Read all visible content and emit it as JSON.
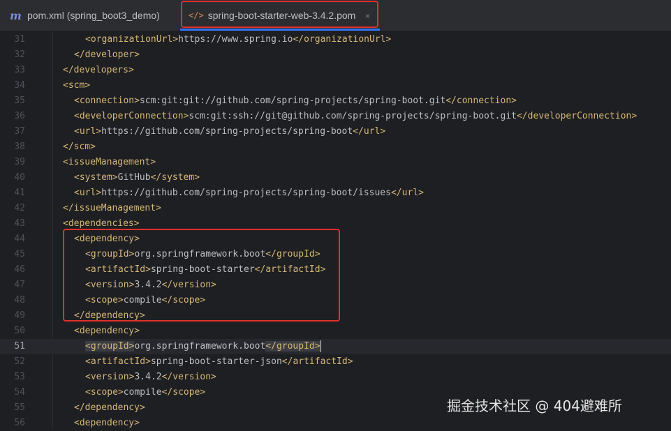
{
  "tabs": [
    {
      "icon": "maven-icon",
      "glyph": "m",
      "label": "pom.xml (spring_boot3_demo)"
    },
    {
      "icon": "xml-icon",
      "glyph": "</>",
      "label": "spring-boot-starter-web-3.4.2.pom",
      "close": "×"
    }
  ],
  "colors": {
    "tag": "#d5b778",
    "text": "#bcbec4",
    "accent": "#3574f0",
    "highlight": "#e0302c"
  },
  "lines": [
    {
      "n": "31",
      "indent": 2,
      "open": "organizationUrl",
      "text": "https://www.spring.io",
      "close": "organizationUrl"
    },
    {
      "n": "32",
      "indent": 1,
      "close": "developer"
    },
    {
      "n": "33",
      "indent": 0,
      "close": "developers"
    },
    {
      "n": "34",
      "indent": 0,
      "open": "scm"
    },
    {
      "n": "35",
      "indent": 1,
      "open": "connection",
      "text": "scm:git:git://github.com/spring-projects/spring-boot.git",
      "close": "connection"
    },
    {
      "n": "36",
      "indent": 1,
      "open": "developerConnection",
      "text": "scm:git:ssh://git@github.com/spring-projects/spring-boot.git",
      "close": "developerConnection"
    },
    {
      "n": "37",
      "indent": 1,
      "open": "url",
      "text": "https://github.com/spring-projects/spring-boot",
      "close": "url"
    },
    {
      "n": "38",
      "indent": 0,
      "close": "scm"
    },
    {
      "n": "39",
      "indent": 0,
      "open": "issueManagement"
    },
    {
      "n": "40",
      "indent": 1,
      "open": "system",
      "text": "GitHub",
      "close": "system"
    },
    {
      "n": "41",
      "indent": 1,
      "open": "url",
      "text": "https://github.com/spring-projects/spring-boot/issues",
      "close": "url"
    },
    {
      "n": "42",
      "indent": 0,
      "close": "issueManagement"
    },
    {
      "n": "43",
      "indent": 0,
      "open": "dependencies"
    },
    {
      "n": "44",
      "indent": 1,
      "open": "dependency"
    },
    {
      "n": "45",
      "indent": 2,
      "open": "groupId",
      "text": "org.springframework.boot",
      "close": "groupId"
    },
    {
      "n": "46",
      "indent": 2,
      "open": "artifactId",
      "text": "spring-boot-starter",
      "close": "artifactId"
    },
    {
      "n": "47",
      "indent": 2,
      "open": "version",
      "text": "3.4.2",
      "close": "version"
    },
    {
      "n": "48",
      "indent": 2,
      "open": "scope",
      "text": "compile",
      "close": "scope"
    },
    {
      "n": "49",
      "indent": 1,
      "close": "dependency"
    },
    {
      "n": "50",
      "indent": 1,
      "open": "dependency"
    },
    {
      "n": "51",
      "indent": 2,
      "open": "groupId",
      "text": "org.springframework.boot",
      "close": "groupId",
      "current": true
    },
    {
      "n": "52",
      "indent": 2,
      "open": "artifactId",
      "text": "spring-boot-starter-json",
      "close": "artifactId"
    },
    {
      "n": "53",
      "indent": 2,
      "open": "version",
      "text": "3.4.2",
      "close": "version"
    },
    {
      "n": "54",
      "indent": 2,
      "open": "scope",
      "text": "compile",
      "close": "scope"
    },
    {
      "n": "55",
      "indent": 1,
      "close": "dependency"
    },
    {
      "n": "56",
      "indent": 1,
      "open": "dependency"
    }
  ],
  "watermark": "掘金技术社区 @ 404避难所"
}
